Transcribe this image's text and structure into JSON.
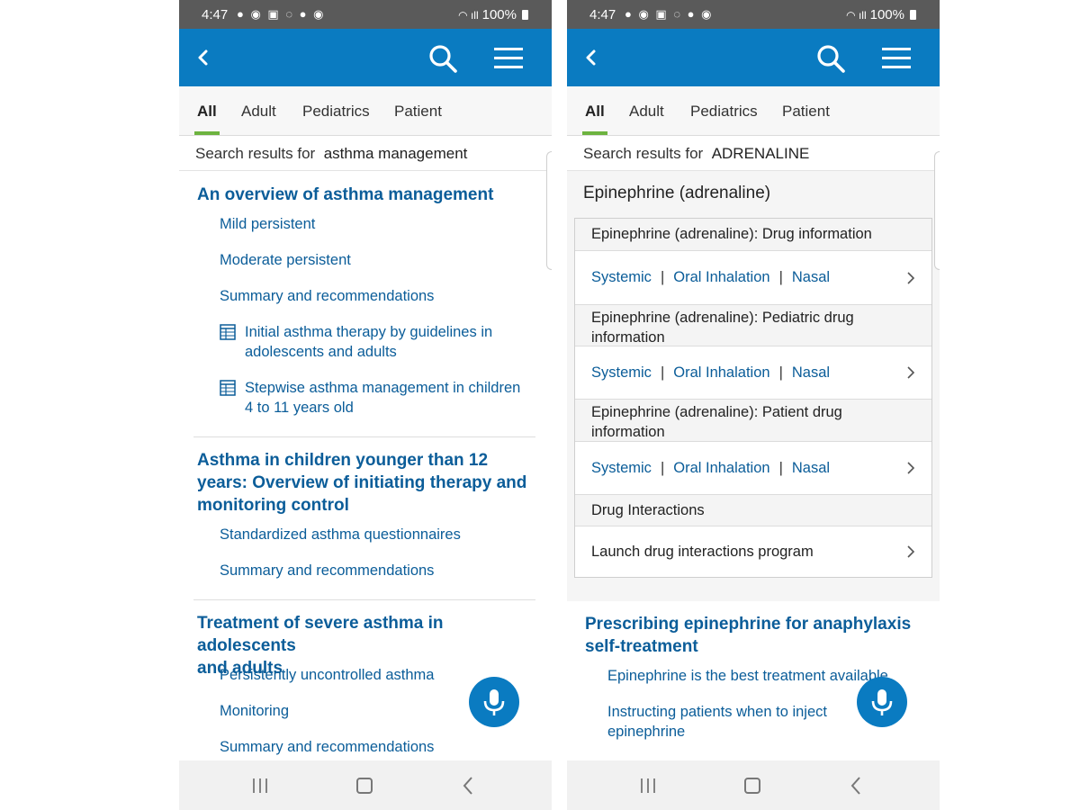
{
  "status": {
    "time": "4:47",
    "battery": "100%"
  },
  "tabs": [
    "All",
    "Adult",
    "Pediatrics",
    "Patient"
  ],
  "left": {
    "search_label": "Search results for",
    "query": "asthma management",
    "results": [
      {
        "title_lines": [
          "An overview of asthma management"
        ],
        "items": [
          "Mild persistent",
          "Moderate persistent",
          "Summary and recommendations"
        ],
        "tables": [
          [
            "Initial asthma therapy by guidelines in",
            "adolescents and adults"
          ],
          [
            "Stepwise asthma management in children",
            "4 to 11 years old"
          ]
        ]
      },
      {
        "title_lines": [
          "Asthma in children younger than 12",
          "years: Overview of initiating therapy and",
          "monitoring control"
        ],
        "items": [
          "Standardized asthma questionnaires",
          "Summary and recommendations"
        ]
      },
      {
        "title_lines": [
          "Treatment of severe asthma in adolescents",
          "and adults"
        ],
        "items": [
          "Persistently uncontrolled asthma",
          "Monitoring",
          "Summary and recommendations"
        ]
      }
    ]
  },
  "right": {
    "search_label": "Search results for",
    "query": "ADRENALINE",
    "drug_heading": "Epinephrine (adrenaline)",
    "sections": [
      {
        "title_lines": [
          "Epinephrine (adrenaline): Drug information"
        ]
      },
      {
        "title_lines": [
          "Epinephrine (adrenaline): Pediatric drug",
          "information"
        ]
      },
      {
        "title_lines": [
          "Epinephrine (adrenaline): Patient drug",
          "information"
        ]
      },
      {
        "title_lines": [
          "Drug Interactions"
        ]
      }
    ],
    "routes": [
      "Systemic",
      "Oral Inhalation",
      "Nasal"
    ],
    "separator": "|",
    "interactions_link": "Launch drug interactions program",
    "result": {
      "title_lines": [
        "Prescribing epinephrine for anaphylaxis",
        "self-treatment"
      ],
      "items": [
        [
          "Epinephrine is the best treatment available"
        ],
        [
          "Instructing patients when to inject",
          "epinephrine"
        ]
      ]
    }
  },
  "colors": {
    "appbar": "#0a7bc1",
    "link": "#0b5d99",
    "tab_indicator": "#6db33f",
    "statusbar": "#5a5a5a"
  },
  "icons": [
    "back-arrow-icon",
    "search-icon",
    "menu-icon",
    "table-icon",
    "chevron-right-icon",
    "microphone-icon",
    "recents-icon",
    "home-icon",
    "nav-back-icon"
  ]
}
